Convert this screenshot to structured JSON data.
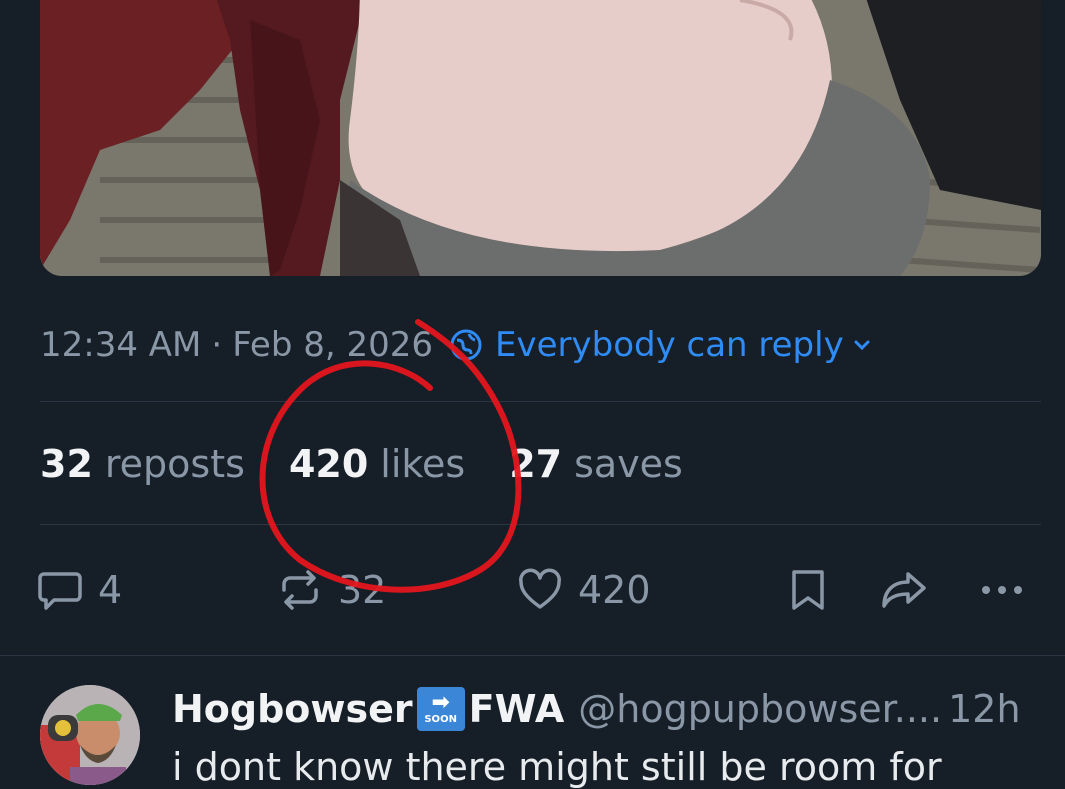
{
  "post": {
    "time": "12:34 AM",
    "separator": "·",
    "date": "Feb 8, 2026",
    "reply_setting": "Everybody can reply"
  },
  "stats": {
    "reposts_count": "32",
    "reposts_label": "reposts",
    "likes_count": "420",
    "likes_label": "likes",
    "saves_count": "27",
    "saves_label": "saves"
  },
  "actions": {
    "reply_count": "4",
    "repost_count": "32",
    "like_count": "420"
  },
  "reply": {
    "display_name_part1": "Hogbowser",
    "badge_arrow": "➡",
    "badge_text": "SOON",
    "display_name_part2": "FWA",
    "handle": "@hogpupbowser....",
    "time": "12h",
    "text": "i dont know there might still be room for"
  },
  "icons": {
    "globe": "globe-icon",
    "chevron": "chevron-down-icon",
    "reply": "speech-bubble-icon",
    "repost": "repost-icon",
    "like": "heart-icon",
    "bookmark": "bookmark-icon",
    "share": "share-icon",
    "more": "more-icon"
  },
  "colors": {
    "background": "#161e27",
    "accent": "#2f8cf6",
    "muted": "#8a97a6",
    "annotation": "#e4161c"
  }
}
